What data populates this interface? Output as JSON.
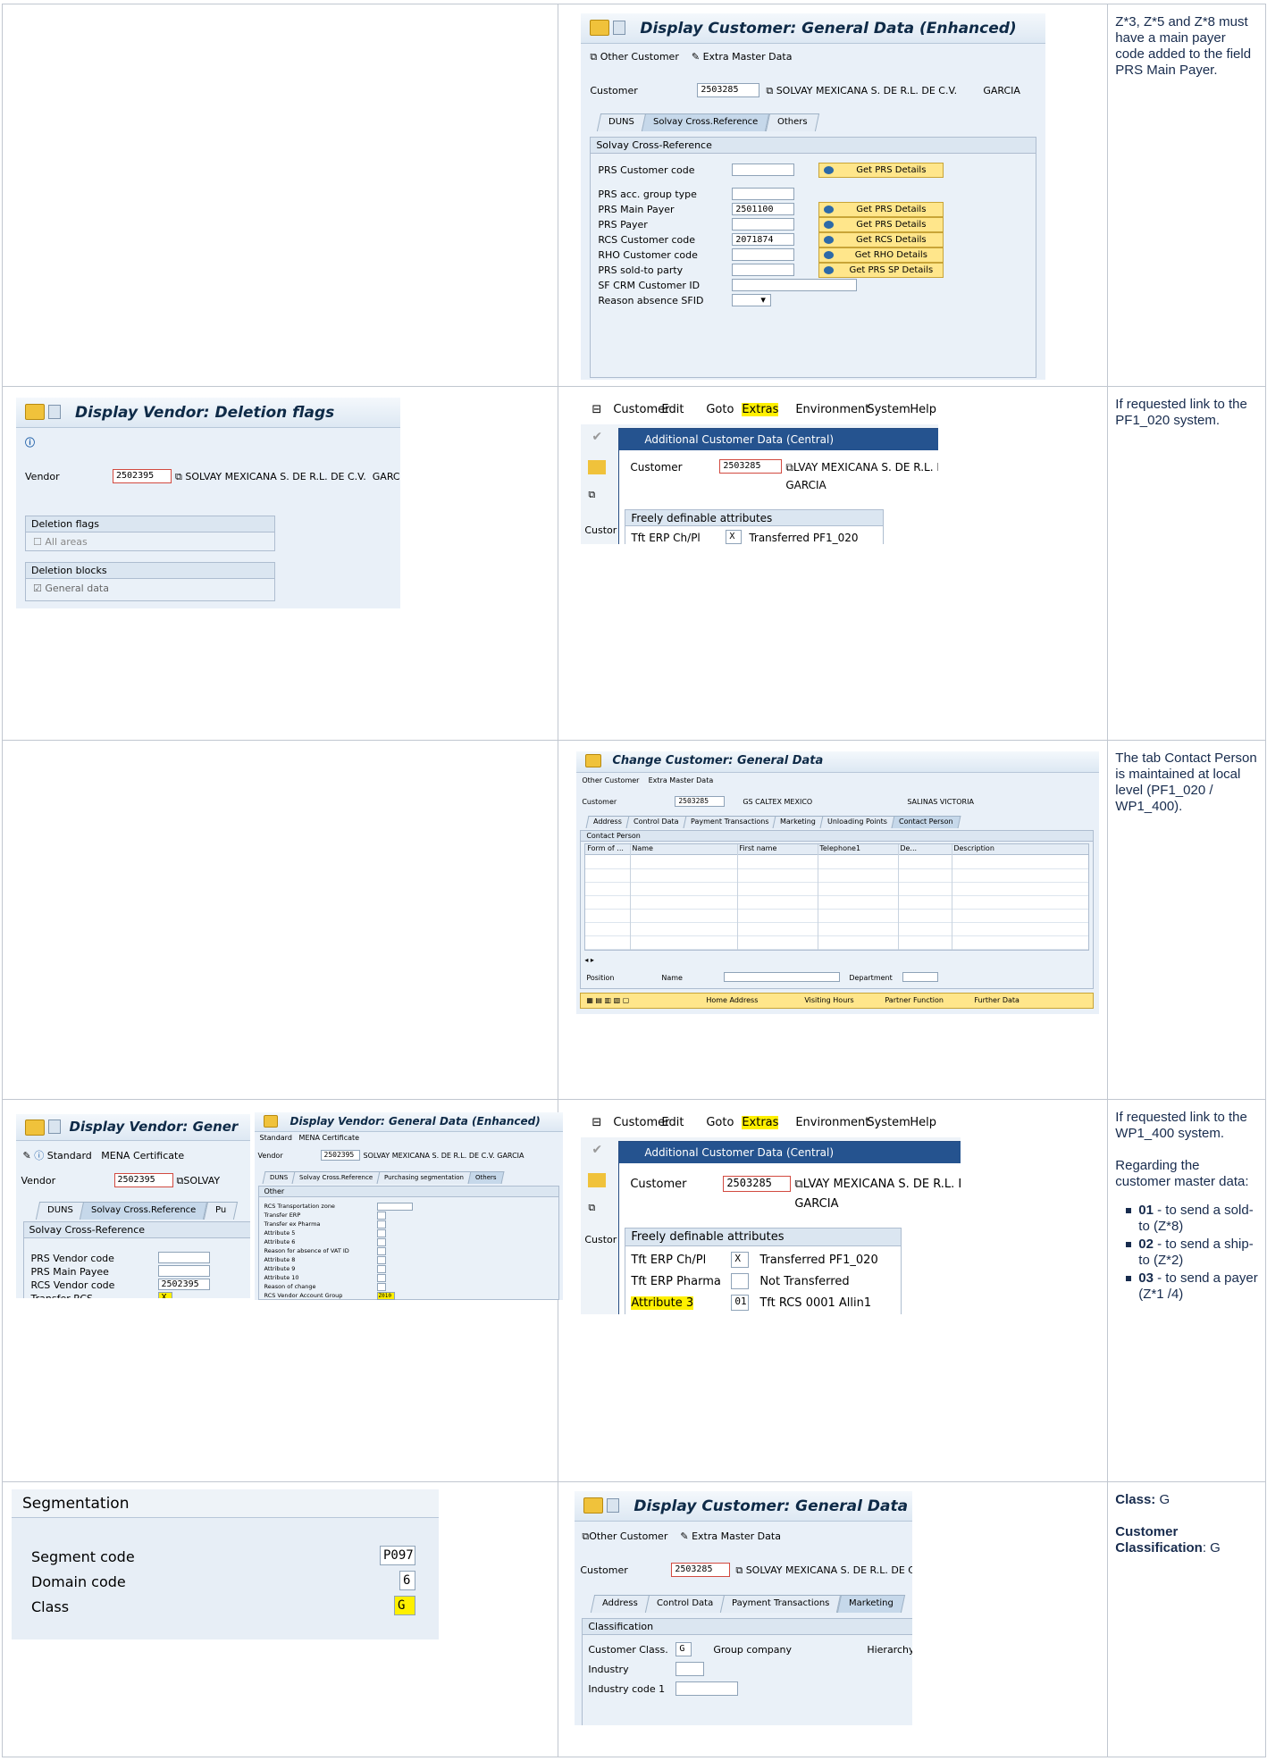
{
  "row1": {
    "title": "Display Customer: General Data (Enhanced)",
    "toolbar": [
      "Other Customer",
      "Extra Master Data"
    ],
    "customer_label": "Customer",
    "customer_value": "2503285",
    "customer_name": "SOLVAY MEXICANA S. DE R.L. DE C.V.",
    "customer_city": "GARCIA",
    "tabs": [
      "DUNS",
      "Solvay Cross.Reference",
      "Others"
    ],
    "group": "Solvay Cross-Reference",
    "fields": [
      {
        "label": "PRS Customer code",
        "value": "",
        "button": "Get PRS Details"
      },
      {
        "label": "PRS acc. group type",
        "value": "",
        "button": ""
      },
      {
        "label": "PRS Main Payer",
        "value": "2501100",
        "button": "Get PRS Details"
      },
      {
        "label": "PRS Payer",
        "value": "",
        "button": "Get PRS Details"
      },
      {
        "label": "RCS Customer code",
        "value": "2071874",
        "button": "Get RCS Details"
      },
      {
        "label": "RHO Customer code",
        "value": "",
        "button": "Get RHO Details"
      },
      {
        "label": "PRS sold-to party",
        "value": "",
        "button": "Get PRS SP Details"
      },
      {
        "label": "SF CRM Customer ID",
        "value": "",
        "button": ""
      },
      {
        "label": "Reason absence SFID",
        "value": "",
        "button": ""
      }
    ],
    "note": "Z*3, Z*5 and Z*8 must have a main payer code added to the field PRS Main Payer."
  },
  "row2": {
    "left_title": "Display Vendor: Deletion flags",
    "vendor_label": "Vendor",
    "vendor_value": "2502395",
    "vendor_name": "SOLVAY MEXICANA S. DE R.L. DE C.V.",
    "vendor_city": "GARCIA",
    "grp1": "Deletion flags",
    "grp1_item": "All areas",
    "grp2": "Deletion blocks",
    "grp2_item": "General data",
    "menu": [
      "Customer",
      "Edit",
      "Goto",
      "Extras",
      "Environment",
      "System",
      "Help"
    ],
    "dialog_title": "Additional Customer Data (Central)",
    "dlg_customer_label": "Customer",
    "dlg_customer_value": "2503285",
    "dlg_customer_name": "LVAY MEXICANA S. DE R.L. DE C.V.",
    "dlg_city": "GARCIA",
    "attr_group": "Freely definable attributes",
    "attr_label": "Tft ERP Ch/Pl",
    "attr_val": "X",
    "attr_desc": "Transferred PF1_020",
    "note": "If requested link to the PF1_020 system."
  },
  "row3": {
    "title": "Change Customer: General Data",
    "toolbar": [
      "Other Customer",
      "Extra Master Data"
    ],
    "customer_label": "Customer",
    "customer_value": "2503285",
    "customer_name": "GS CALTEX MEXICO",
    "customer_city": "SALINAS VICTORIA",
    "tabs": [
      "Address",
      "Control Data",
      "Payment Transactions",
      "Marketing",
      "Unloading Points",
      "Contact Person"
    ],
    "group": "Contact Person",
    "cols": [
      "Form of ...",
      "Name",
      "First name",
      "Telephone1",
      "De...",
      "Description"
    ],
    "position_label": "Position",
    "name_label": "Name",
    "dept_label": "Department",
    "buttons": [
      "Home Address",
      "Visiting Hours",
      "Partner Function",
      "Further Data"
    ],
    "note": "The tab Contact Person is maintained at local level (PF1_020 / WP1_400)."
  },
  "row4": {
    "a_title": "Display Vendor: Gener",
    "a_toolbar": [
      "Standard",
      "MENA Certificate"
    ],
    "a_vendor_label": "Vendor",
    "a_vendor_value": "2502395",
    "a_vendor_name": "SOLVAY",
    "a_tabs": [
      "DUNS",
      "Solvay Cross.Reference",
      "Pu"
    ],
    "a_group": "Solvay Cross-Reference",
    "a_fields": [
      {
        "label": "PRS Vendor code",
        "value": ""
      },
      {
        "label": "PRS Main Payee",
        "value": ""
      },
      {
        "label": "RCS Vendor code",
        "value": "2502395"
      },
      {
        "label": "Transfer RCS",
        "value": "X"
      }
    ],
    "b_title": "Display Vendor: General Data (Enhanced)",
    "b_toolbar": [
      "Standard",
      "MENA Certificate"
    ],
    "b_vendor_label": "Vendor",
    "b_vendor_value": "2502395",
    "b_vendor_name": "SOLVAY MEXICANA S. DE R.L. DE C.V.",
    "b_city": "GARCIA",
    "b_tabs": [
      "DUNS",
      "Solvay Cross.Reference",
      "Purchasing segmentation",
      "Others"
    ],
    "b_group": "Other",
    "b_fields": [
      "RCS Transportation zone",
      "Transfer ERP",
      "Transfer ex Pharma",
      "Attribute 5",
      "Attribute 6",
      "Reason for absence of VAT ID",
      "Attribute 8",
      "Attribute 9",
      "Attribute 10",
      "Reason of change",
      "RCS Vendor Account Group"
    ],
    "b_last_value": "Z010",
    "menu": [
      "Customer",
      "Edit",
      "Goto",
      "Extras",
      "Environment",
      "System",
      "Help"
    ],
    "dialog_title": "Additional Customer Data (Central)",
    "dlg_customer_label": "Customer",
    "dlg_customer_value": "2503285",
    "dlg_customer_name": "LVAY MEXICANA S. DE R.L. DE C.V.",
    "dlg_city": "GARCIA",
    "attr_group": "Freely definable attributes",
    "attrs": [
      {
        "label": "Tft ERP Ch/Pl",
        "val": "X",
        "desc": "Transferred PF1_020"
      },
      {
        "label": "Tft ERP Pharma",
        "val": "",
        "desc": "Not Transferred"
      },
      {
        "label": "Attribute 3",
        "val": "01",
        "desc": "Tft RCS 0001 Allin1"
      }
    ],
    "note1": "If requested link to the WP1_400 system.",
    "note2": "Regarding the customer master data:",
    "bullets": [
      {
        "code": "01",
        "text": " - to send a sold-to (Z*8)"
      },
      {
        "code": "02",
        "text": " - to send a ship-to (Z*2)"
      },
      {
        "code": "03",
        "text": " - to send a payer (Z*1 /4)"
      }
    ]
  },
  "row5": {
    "seg_title": "Segmentation",
    "seg_fields": [
      {
        "label": "Segment code",
        "value": "P097"
      },
      {
        "label": "Domain code",
        "value": "6"
      },
      {
        "label": "Class",
        "value": "G"
      }
    ],
    "title": "Display Customer: General Data",
    "toolbar": [
      "Other Customer",
      "Extra Master Data"
    ],
    "customer_label": "Customer",
    "customer_value": "2503285",
    "customer_name": "SOLVAY MEXICANA S. DE R.L. DE C.V.",
    "tabs": [
      "Address",
      "Control Data",
      "Payment Transactions",
      "Marketing"
    ],
    "group": "Classification",
    "cc_label": "Customer Class.",
    "cc_value": "G",
    "cc_desc": "Group company",
    "hier": "Hierarchy a",
    "ind_label": "Industry",
    "ind1_label": "Industry code 1",
    "note_class_label": "Class:",
    "note_class_value": " G",
    "note_cc_label": "Customer Classification",
    "note_cc_value": ": G"
  }
}
